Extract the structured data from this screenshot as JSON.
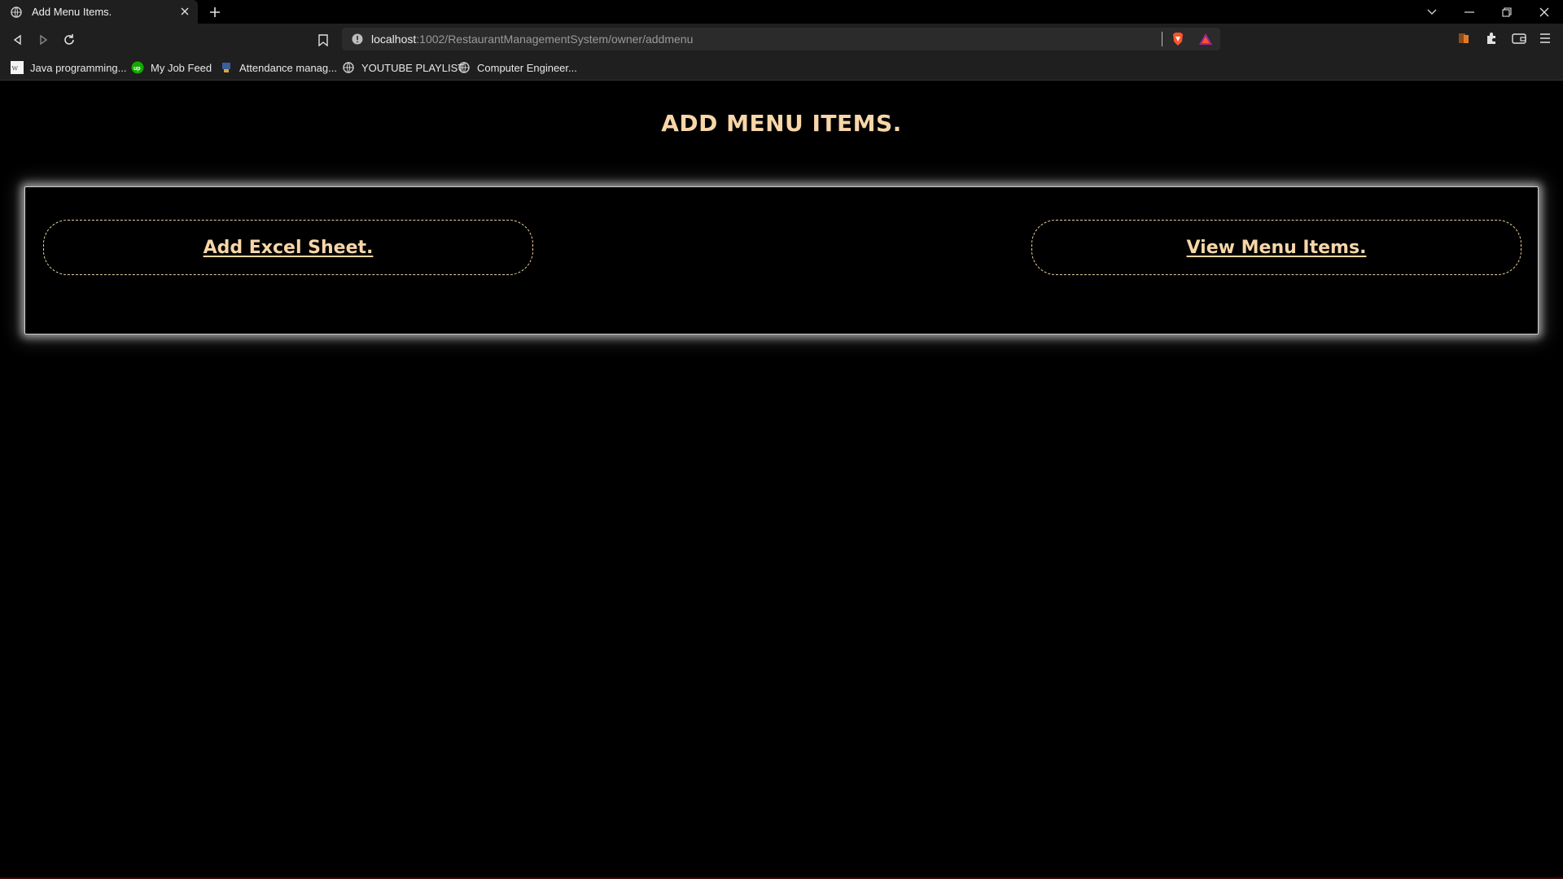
{
  "browser": {
    "tab_title": "Add Menu Items.",
    "url_host": "localhost",
    "url_path": ":1002/RestaurantManagementSystem/owner/addmenu",
    "bookmarks": [
      {
        "label": "Java programming...",
        "icon": "wikipedia-icon"
      },
      {
        "label": "My Job Feed",
        "icon": "upwork-icon"
      },
      {
        "label": "Attendance manag...",
        "icon": "app-icon"
      },
      {
        "label": "YOUTUBE PLAYLIST",
        "icon": "globe-icon"
      },
      {
        "label": "Computer Engineer...",
        "icon": "globe-icon"
      }
    ]
  },
  "page": {
    "title": "ADD MENU ITEMS.",
    "actions": {
      "add_excel": "Add Excel Sheet.",
      "view_menu": "View Menu Items."
    }
  },
  "colors": {
    "accent": "#f7d6a8",
    "background": "#000000",
    "chrome": "#1f1f1f"
  }
}
